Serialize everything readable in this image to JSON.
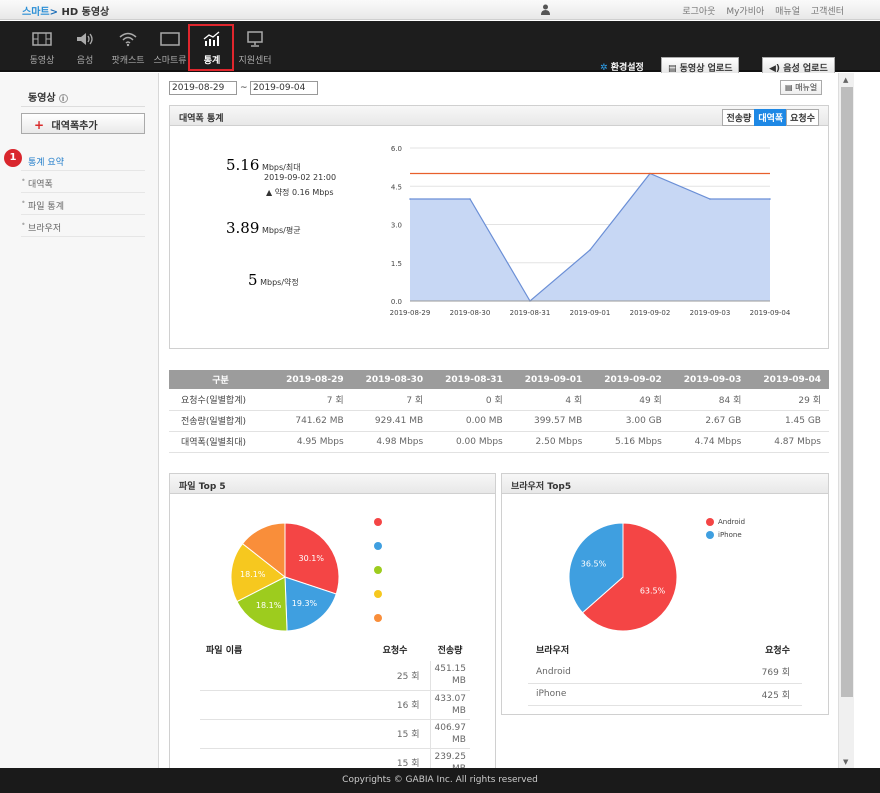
{
  "topbar": {
    "brand_smart": "스마트",
    "brand_hd": "HD",
    "brand_video": "동영상",
    "links": [
      "로그아웃",
      "My가비아",
      "매뉴얼",
      "고객센터"
    ]
  },
  "nav": {
    "items": [
      {
        "label": "동영상",
        "icon": "film-icon"
      },
      {
        "label": "음성",
        "icon": "speaker-icon"
      },
      {
        "label": "팟캐스트",
        "icon": "wifi-icon"
      },
      {
        "label": "스마트류",
        "icon": "screen-icon"
      },
      {
        "label": "통계",
        "icon": "stats-chart-icon"
      },
      {
        "label": "지원센터",
        "icon": "monitor-icon"
      }
    ],
    "active": "통계",
    "settings_label": "환경설정",
    "video_upload_label": "동영상 업로드",
    "audio_upload_label": "음성 업로드"
  },
  "sidebar": {
    "title": "동영상",
    "info": "i",
    "add_button": "대역폭추가",
    "badge": "1",
    "menu": [
      {
        "label": "통계 요약",
        "active": true
      },
      {
        "label": "대역폭",
        "active": false
      },
      {
        "label": "파일 통계",
        "active": false
      },
      {
        "label": "브라우저",
        "active": false
      }
    ]
  },
  "filter": {
    "date_from": "2019-08-29",
    "tilde": "~",
    "date_to": "2019-09-04",
    "manual_label": "매뉴얼"
  },
  "bandwidth": {
    "title": "대역폭 통계",
    "tabs": [
      "전송량",
      "대역폭",
      "요청수"
    ],
    "active_tab": "대역폭",
    "max_value": "5.16",
    "max_unit": "Mbps/최대",
    "max_time": "2019-09-02 21:00",
    "over_note": "▲ 약정 0.16 Mbps",
    "avg_value": "3.89",
    "avg_unit": "Mbps/평균",
    "contract_value": "5",
    "contract_unit": "Mbps/약정"
  },
  "chart_data": [
    {
      "type": "area",
      "x": [
        "2019-08-29",
        "2019-08-30",
        "2019-08-31",
        "2019-09-01",
        "2019-09-02",
        "2019-09-03",
        "2019-09-04"
      ],
      "series": [
        {
          "values": [
            4.0,
            4.0,
            0.0,
            2.0,
            5.0,
            4.0,
            4.0
          ]
        }
      ],
      "reference_line": 5.0,
      "yticks": [
        "0.0",
        "1.5",
        "3.0",
        "4.5",
        "6.0"
      ],
      "ylim": [
        0,
        6
      ],
      "grid": true,
      "fill_color": "#c7d7f4",
      "line_color": "#6b8fd6",
      "ref_color": "#e8602c"
    },
    {
      "type": "pie",
      "labels": [
        "",
        "",
        "",
        "",
        ""
      ],
      "values": [
        30.1,
        19.3,
        18.1,
        18.1,
        14.4
      ],
      "value_labels": [
        "30.1%",
        "19.3%",
        "18.1%",
        "18.1%",
        ""
      ],
      "colors": [
        "#f44545",
        "#3f9fe0",
        "#9dcc1e",
        "#f6c81f",
        "#f98e3a"
      ]
    },
    {
      "type": "pie",
      "labels": [
        "Android",
        "iPhone"
      ],
      "values": [
        63.5,
        36.5
      ],
      "value_labels": [
        "63.5%",
        "36.5%"
      ],
      "colors": [
        "#f44545",
        "#3f9fe0"
      ]
    }
  ],
  "summary_table": {
    "header": [
      "구분",
      "2019-08-29",
      "2019-08-30",
      "2019-08-31",
      "2019-09-01",
      "2019-09-02",
      "2019-09-03",
      "2019-09-04"
    ],
    "rows": [
      [
        "요청수(일별합계)",
        "7 회",
        "7 회",
        "0 회",
        "4 회",
        "49 회",
        "84 회",
        "29 회"
      ],
      [
        "전송량(일별합계)",
        "741.62 MB",
        "929.41 MB",
        "0.00 MB",
        "399.57 MB",
        "3.00 GB",
        "2.67 GB",
        "1.45 GB"
      ],
      [
        "대역폭(일별최대)",
        "4.95 Mbps",
        "4.98 Mbps",
        "0.00 Mbps",
        "2.50 Mbps",
        "5.16 Mbps",
        "4.74 Mbps",
        "4.87 Mbps"
      ]
    ]
  },
  "file_top5": {
    "title": "파일 Top 5",
    "columns": [
      "파일 이름",
      "요청수",
      "전송량"
    ],
    "rows": [
      {
        "name": "",
        "count": "25 회",
        "size1": "451.15",
        "size2": "MB",
        "highlight": true
      },
      {
        "name": "",
        "count": "16 회",
        "size1": "433.07",
        "size2": "MB",
        "highlight": false
      },
      {
        "name": "",
        "count": "15 회",
        "size1": "406.97",
        "size2": "MB",
        "highlight": false
      },
      {
        "name": "",
        "count": "15 회",
        "size1": "239.25",
        "size2": "MB",
        "highlight": false
      }
    ]
  },
  "browser_top5": {
    "title": "브라우저 Top5",
    "columns": [
      "브라우저",
      "요청수"
    ],
    "rows": [
      {
        "name": "Android",
        "count": "769 회",
        "highlight": true
      },
      {
        "name": "iPhone",
        "count": "425 회",
        "highlight": false
      }
    ]
  },
  "footer": {
    "text": "Copyrights © GABIA Inc. All rights reserved"
  }
}
